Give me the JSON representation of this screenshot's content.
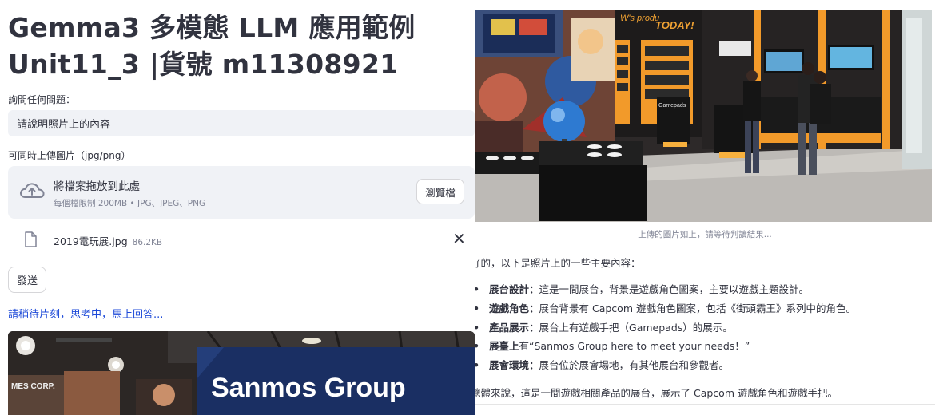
{
  "app": {
    "title_line1": "Gemma3 多模態 LLM 應用範例",
    "title_line2": "Unit11_3 |貨號 m11308921"
  },
  "question": {
    "label": "詢問任何問題：",
    "value": "請說明照片上的內容"
  },
  "upload": {
    "label": "可同時上傳圖片（jpg/png）",
    "drop_text": "將檔案拖放到此處",
    "limit_text": "每個檔限制 200MB • JPG、JPEG、PNG",
    "browse_label": "瀏覽檔",
    "icon": "cloud-upload-icon",
    "file": {
      "name": "2019電玩展.jpg",
      "size": "86.2KB",
      "icon": "file-icon",
      "remove_icon": "close-icon"
    }
  },
  "send_label": "發送",
  "waiting_text": "請稍待片刻，思考中，馬上回答...",
  "left_photo_texts": {
    "logo": "Sanmos Group",
    "sign": "MES CORP."
  },
  "right_photo_texts": {
    "today": "TODAY!",
    "banner": "W's produ",
    "gamepads": "Gamepads"
  },
  "image_caption": "上傳的圖片如上，請等待判讀結果...",
  "answer": {
    "intro": "好的，以下是照片上的一些主要內容：",
    "bullets": [
      {
        "key": "展台設計：",
        "text": "這是一間展台，背景是遊戲角色圖案，主要以遊戲主題設計。"
      },
      {
        "key": "遊戲角色：",
        "text": "展台背景有 Capcom 遊戲角色圖案，包括《街頭霸王》系列中的角色。"
      },
      {
        "key": "產品展示：",
        "text": "展台上有遊戲手把（Gamepads）的展示。"
      },
      {
        "key": "展臺上",
        "text": "有“Sanmos Group here to meet your needs！”"
      },
      {
        "key": "展會環境：",
        "text": "展台位於展會場地，有其他展台和參觀者。"
      }
    ],
    "summary": "總體來說，這是一間遊戲相關產品的展台，展示了 Capcom 遊戲角色和遊戲手把。"
  },
  "colors": {
    "accent_link": "#1c49d8",
    "input_bg": "#f0f2f6",
    "text": "#31333f",
    "muted": "#808495"
  }
}
